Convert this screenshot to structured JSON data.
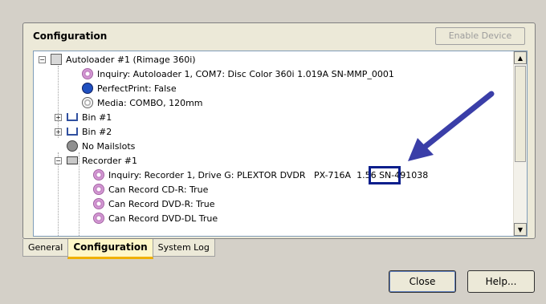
{
  "group": {
    "title": "Configuration",
    "enable_button": "Enable Device"
  },
  "tree": {
    "items": [
      {
        "label": "Autoloader #1 (Rimage 360i)",
        "icon": "autoloader-icon",
        "expander": "−"
      },
      {
        "label": "Inquiry: Autoloader 1, COM7: Disc Color 360i 1.019A SN-MMP_0001",
        "icon": "disc-icon"
      },
      {
        "label": "PerfectPrint: False",
        "icon": "perfectprint-icon"
      },
      {
        "label": "Media: COMBO, 120mm",
        "icon": "media-icon"
      },
      {
        "label": "Bin #1",
        "icon": "bin-icon",
        "expander": "+"
      },
      {
        "label": "Bin #2",
        "icon": "bin-icon",
        "expander": "+"
      },
      {
        "label": "No Mailslots",
        "icon": "mailslot-icon"
      },
      {
        "label": "Recorder #1",
        "icon": "recorder-icon",
        "expander": "−"
      },
      {
        "label": "Inquiry: Recorder 1, Drive G: PLEXTOR DVDR   PX-716A  1.56 SN-491038",
        "icon": "disc-icon"
      },
      {
        "label": "Can Record CD-R: True",
        "icon": "disc-icon"
      },
      {
        "label": "Can Record DVD-R: True",
        "icon": "disc-icon"
      },
      {
        "label": "Can Record DVD-DL True",
        "icon": "disc-icon"
      }
    ]
  },
  "tabs": [
    {
      "label": "General",
      "active": false
    },
    {
      "label": "Configuration",
      "active": true
    },
    {
      "label": "System Log",
      "active": false
    }
  ],
  "buttons": {
    "close": "Close",
    "help": "Help..."
  },
  "colors": {
    "highlight": "#0a1e8c",
    "arrow": "#3a3ea8",
    "active_tab": "#fff7c8"
  }
}
